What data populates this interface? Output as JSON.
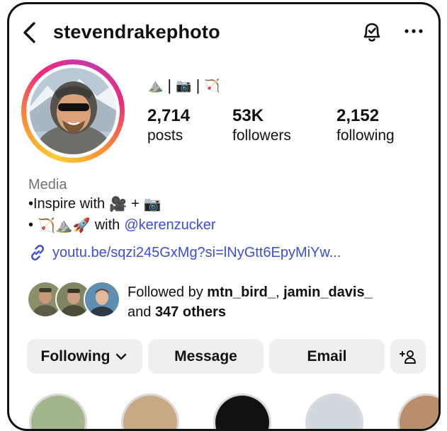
{
  "header": {
    "username": "stevendrakephoto",
    "back_icon": "chevron-left-icon",
    "notification_icon": "bell-check-icon",
    "more_icon": "more-horizontal-icon"
  },
  "profile": {
    "emoji_line": [
      "⛰️",
      "|",
      "📷",
      "|",
      "🏹"
    ],
    "stats": [
      {
        "value": "2,714",
        "label": "posts"
      },
      {
        "value": "53K",
        "label": "followers"
      },
      {
        "value": "2,152",
        "label": "following"
      }
    ]
  },
  "bio": {
    "category": "Media",
    "line1_text": "•Inspire with",
    "line1_emoji1": "🎥",
    "line1_plus": "+",
    "line1_emoji2": "📷",
    "line2_bullet": "•",
    "line2_emojis": "🏹⛰️🚀",
    "line2_with": "with",
    "line2_mention": "@kerenzucker",
    "link": "youtu.be/sqzi245GxMg?si=lNyGtt6EpyMiYw..."
  },
  "followed_by": {
    "prefix": "Followed by ",
    "user1": "mtn_bird_",
    "comma": ", ",
    "user2": "jamin_davis_",
    "and": "and ",
    "others": "347 others"
  },
  "actions": {
    "following": "Following",
    "message": "Message",
    "email": "Email"
  },
  "colors": {
    "link": "#3a4fd6",
    "button_bg": "#efefef",
    "muted": "#737373"
  }
}
